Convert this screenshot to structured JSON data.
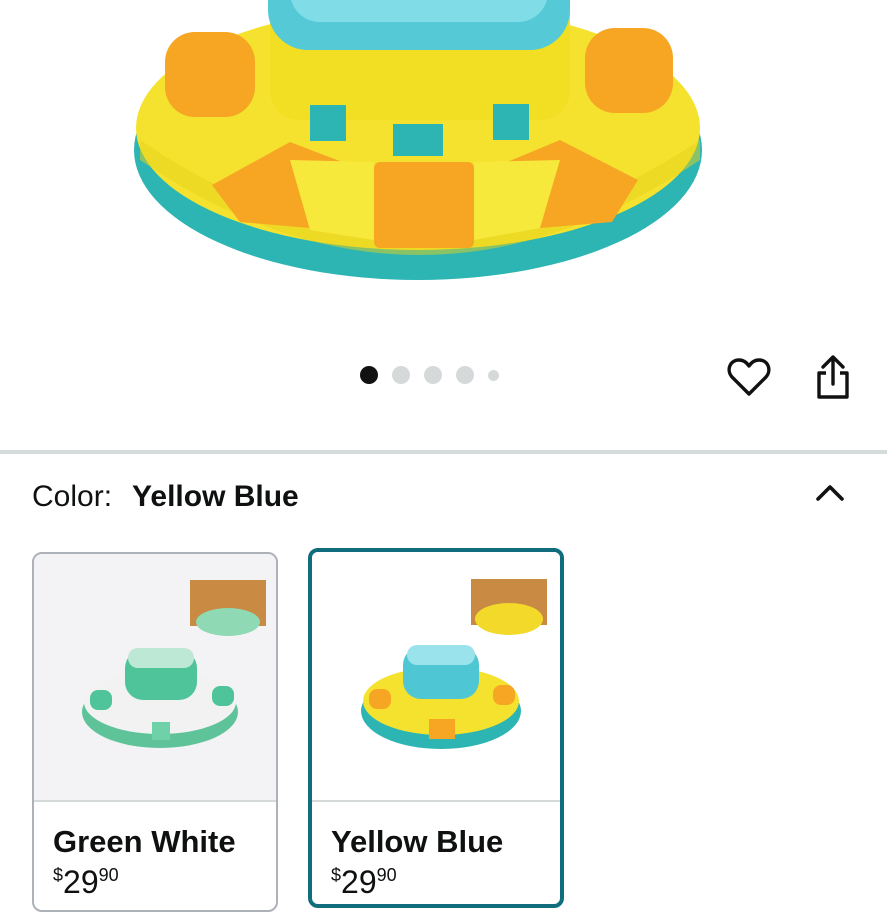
{
  "product_image": {
    "description_icon": "dog-puzzle-feeder",
    "colors": {
      "yellow": "#f4e22e",
      "teal": "#2db5b3",
      "orange": "#f6a623",
      "lid": "#7fdbe8"
    }
  },
  "carousel": {
    "count": 5,
    "active_index": 0
  },
  "actions": {
    "favorite_icon": "heart-icon",
    "share_icon": "share-icon"
  },
  "variation": {
    "label": "Color:",
    "selected_value": "Yellow Blue",
    "collapse_icon": "chevron-up-icon",
    "options": [
      {
        "name": "Green White",
        "price_symbol": "$",
        "price_whole": "29",
        "price_fraction": "90",
        "selected": false
      },
      {
        "name": "Yellow Blue",
        "price_symbol": "$",
        "price_whole": "29",
        "price_fraction": "90",
        "selected": true
      }
    ]
  },
  "colors": {
    "selected_border": "#0f6d7d",
    "divider": "#d5dbdb"
  }
}
